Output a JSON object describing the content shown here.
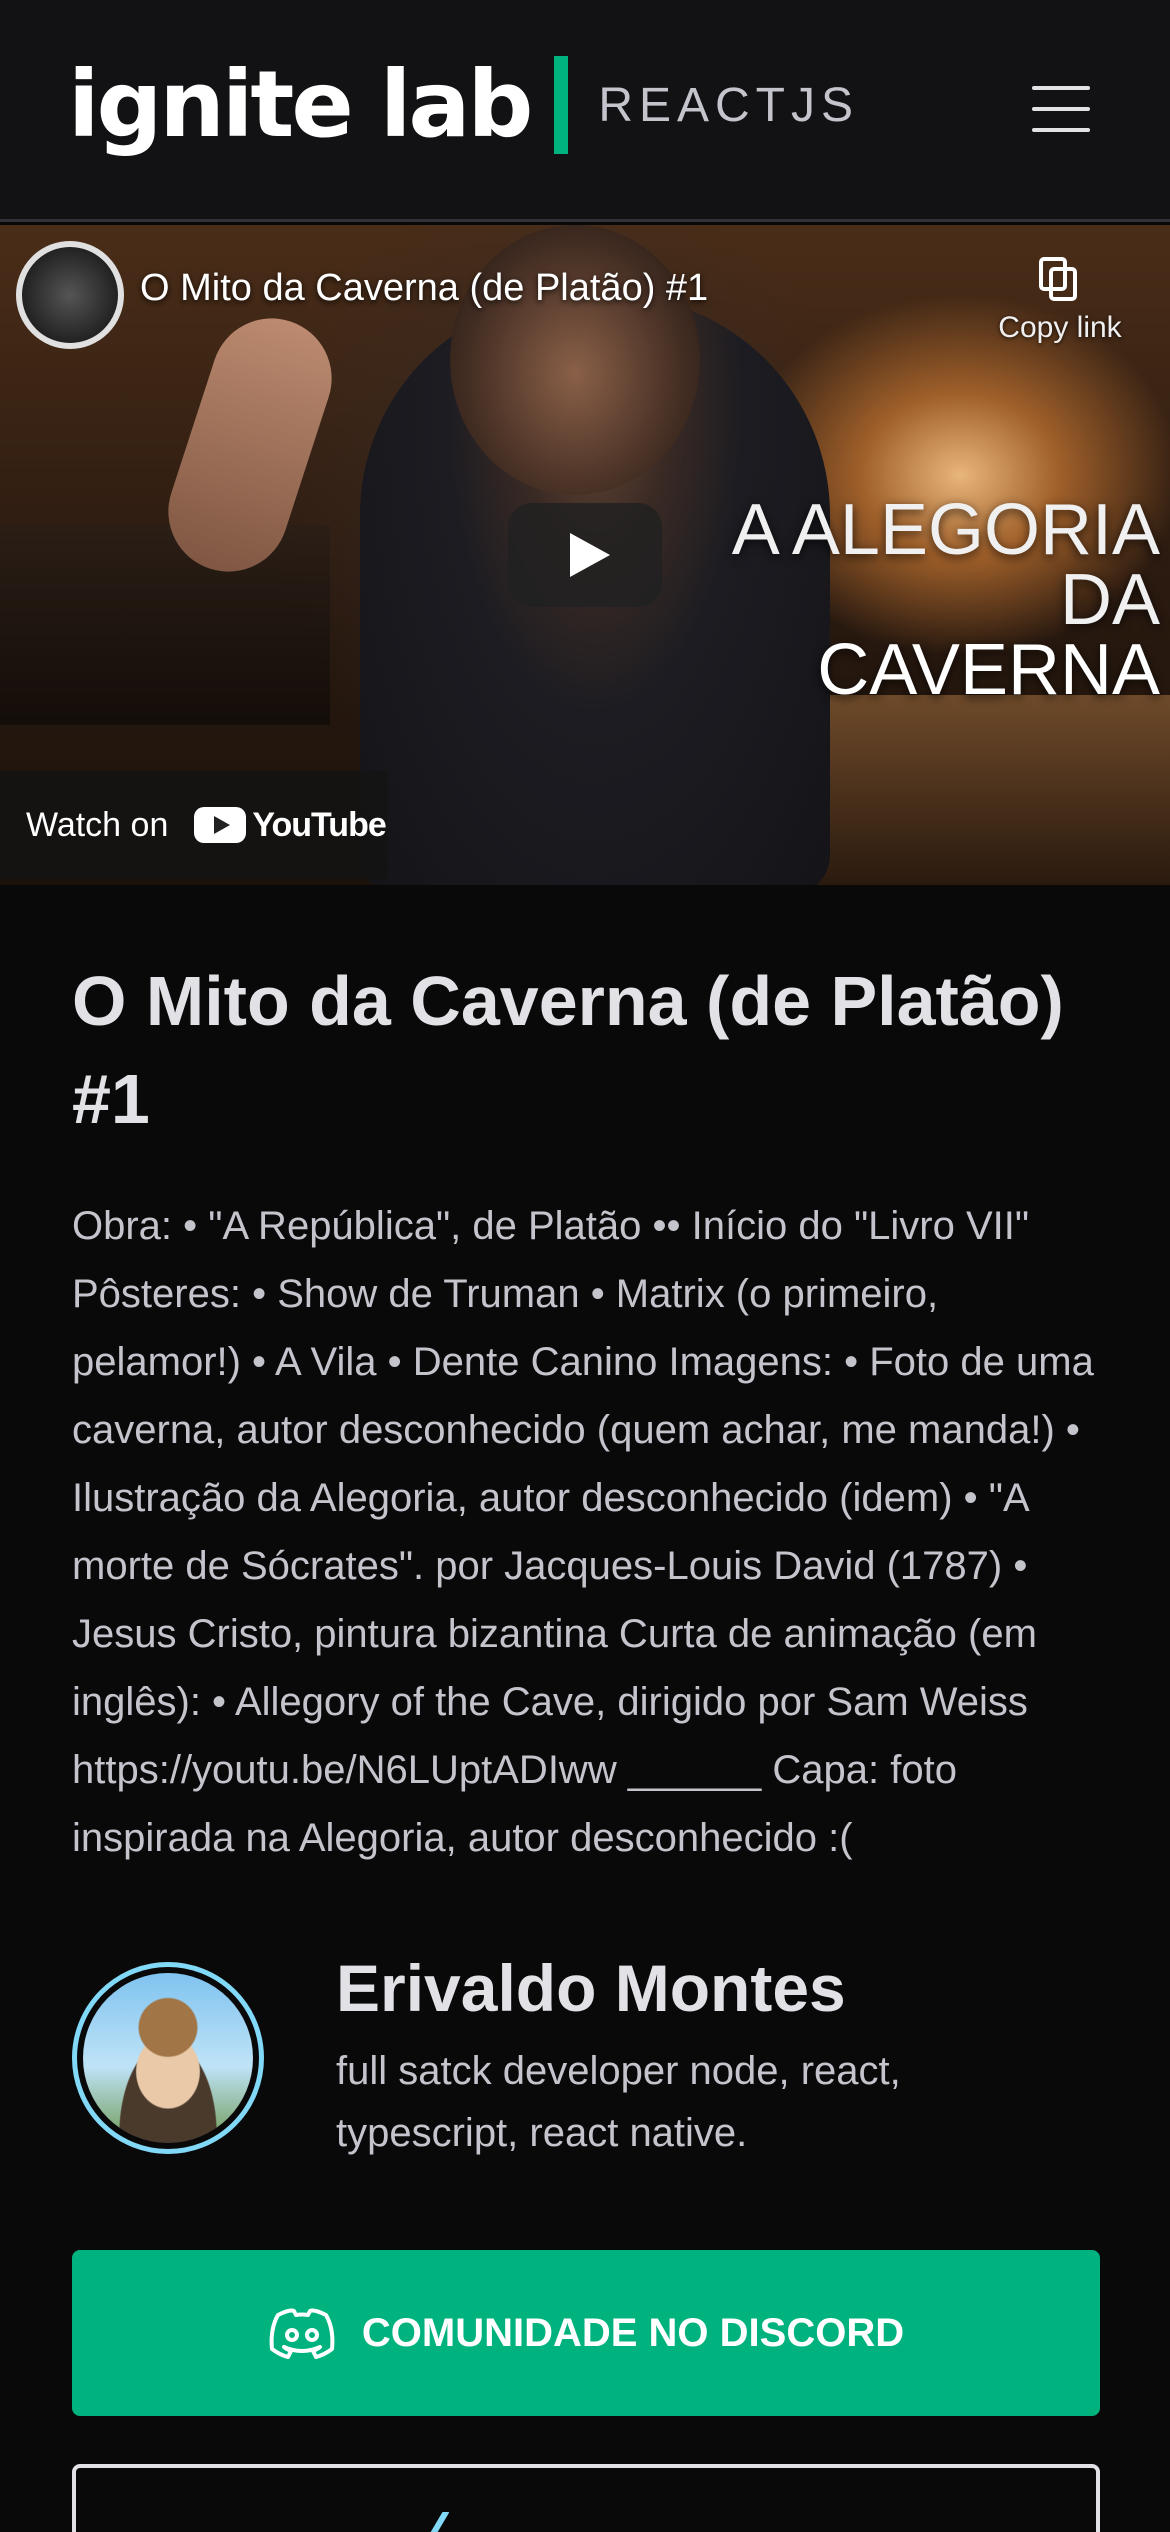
{
  "header": {
    "logo_main": "ignite lab",
    "logo_sub": "REACTJS",
    "accent_color": "#00b37e",
    "menu_icon": "hamburger-menu-icon"
  },
  "video": {
    "title": "O Mito da Caverna (de Platão) #1",
    "copy_link_label": "Copy link",
    "overlay_line1": "A ALEGORIA DA",
    "overlay_line2": "CAVERNA",
    "watch_on_label": "Watch on",
    "youtube_label": "YouTube"
  },
  "lesson": {
    "title": "O Mito da Caverna (de Platão) #1",
    "description": "Obra: • \"A República\", de Platão •• Início do \"Livro VII\" Pôsteres: • Show de Truman • Matrix (o primeiro, pelamor!) • A Vila • Dente Canino Imagens: • Foto de uma caverna, autor desconhecido (quem achar, me manda!) • Ilustração da Alegoria, autor desconhecido (idem) • \"A morte de Sócrates\". por Jacques-Louis David (1787) • Jesus Cristo, pintura bizantina Curta de animação (em inglês): • Allegory of the Cave, dirigido por Sam Weiss https://youtu.be/N6LUptADIww ______ Capa: foto inspirada na Alegoria, autor desconhecido :("
  },
  "teacher": {
    "name": "Erivaldo Montes",
    "bio": "full satck developer node, react, typescript, react native."
  },
  "actions": {
    "discord_label": "COMUNIDADE NO DISCORD",
    "discord_icon": "discord-icon",
    "discord_color": "#00b37e"
  }
}
